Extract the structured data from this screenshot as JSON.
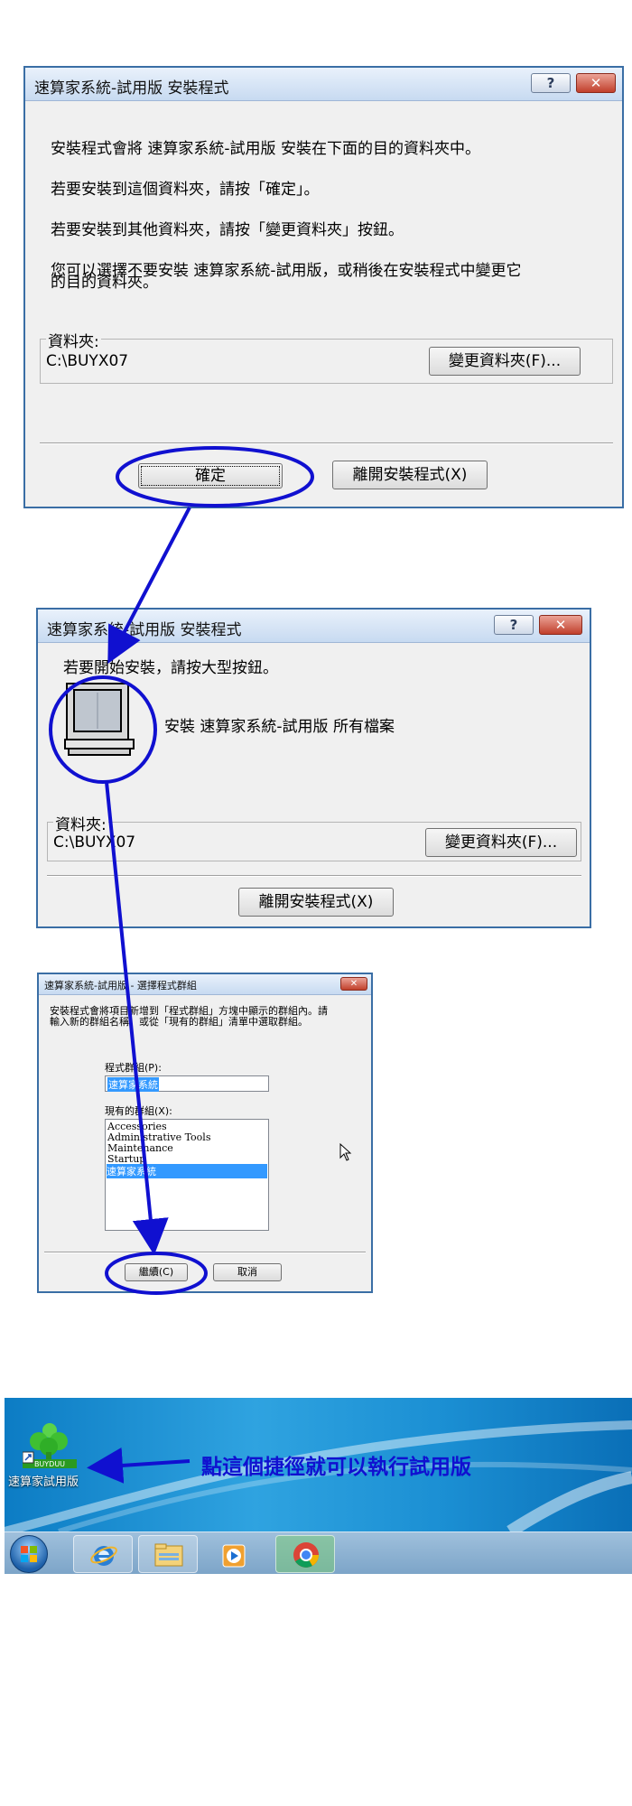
{
  "dialog1": {
    "title": "速算家系統-試用版 安裝程式",
    "help_glyph": "?",
    "close_glyph": "✕",
    "line1": "安裝程式會將 速算家系統-試用版 安裝在下面的目的資料夾中。",
    "line2": "若要安裝到這個資料夾，請按「確定」。",
    "line3": "若要安裝到其他資料夾，請按「變更資料夾」按鈕。",
    "line4a": "您可以選擇不要安裝 速算家系統-試用版，或稍後在安裝程式中變更它",
    "line4b": "的目的資料夾。",
    "folder_label": "資料夾:",
    "folder_path": "C:\\BUYX07",
    "change_folder": "變更資料夾(F)...",
    "ok": "確定",
    "exit": "離開安裝程式(X)"
  },
  "dialog2": {
    "title": "速算家系統-試用版 安裝程式",
    "help_glyph": "?",
    "close_glyph": "✕",
    "instruction": "若要開始安裝，請按大型按鈕。",
    "install_all": "安裝 速算家系統-試用版 所有檔案",
    "folder_label": "資料夾:",
    "folder_path": "C:\\BUYX07",
    "change_folder": "變更資料夾(F)...",
    "exit": "離開安裝程式(X)"
  },
  "dialog3": {
    "title": "速算家系統-試用版 - 選擇程式群組",
    "close_glyph": "✕",
    "desc1": "安裝程式會將項目新增到「程式群組」方塊中顯示的群組內。請",
    "desc2": "輸入新的群組名稱，或從「現有的群組」清單中選取群組。",
    "group_label": "程式群組(P):",
    "group_value": "速算家系統",
    "existing_label": "現有的群組(X):",
    "existing_groups": [
      "Accessories",
      "Administrative Tools",
      "Maintenance",
      "Startup",
      "速算家系統"
    ],
    "continue": "繼續(C)",
    "cancel": "取消"
  },
  "desktop": {
    "shortcut_label": "速算家試用版",
    "shortcut_logo_text": "BUYDUU",
    "annotation": "點這個捷徑就可以執行試用版",
    "taskbar_items": [
      "start-orb",
      "ie-icon",
      "file-explorer-icon",
      "media-player-icon",
      "chrome-icon"
    ]
  },
  "colors": {
    "annotation_blue": "#1010d0",
    "selection_blue": "#3399ff",
    "window_border": "#3a6ea5"
  }
}
